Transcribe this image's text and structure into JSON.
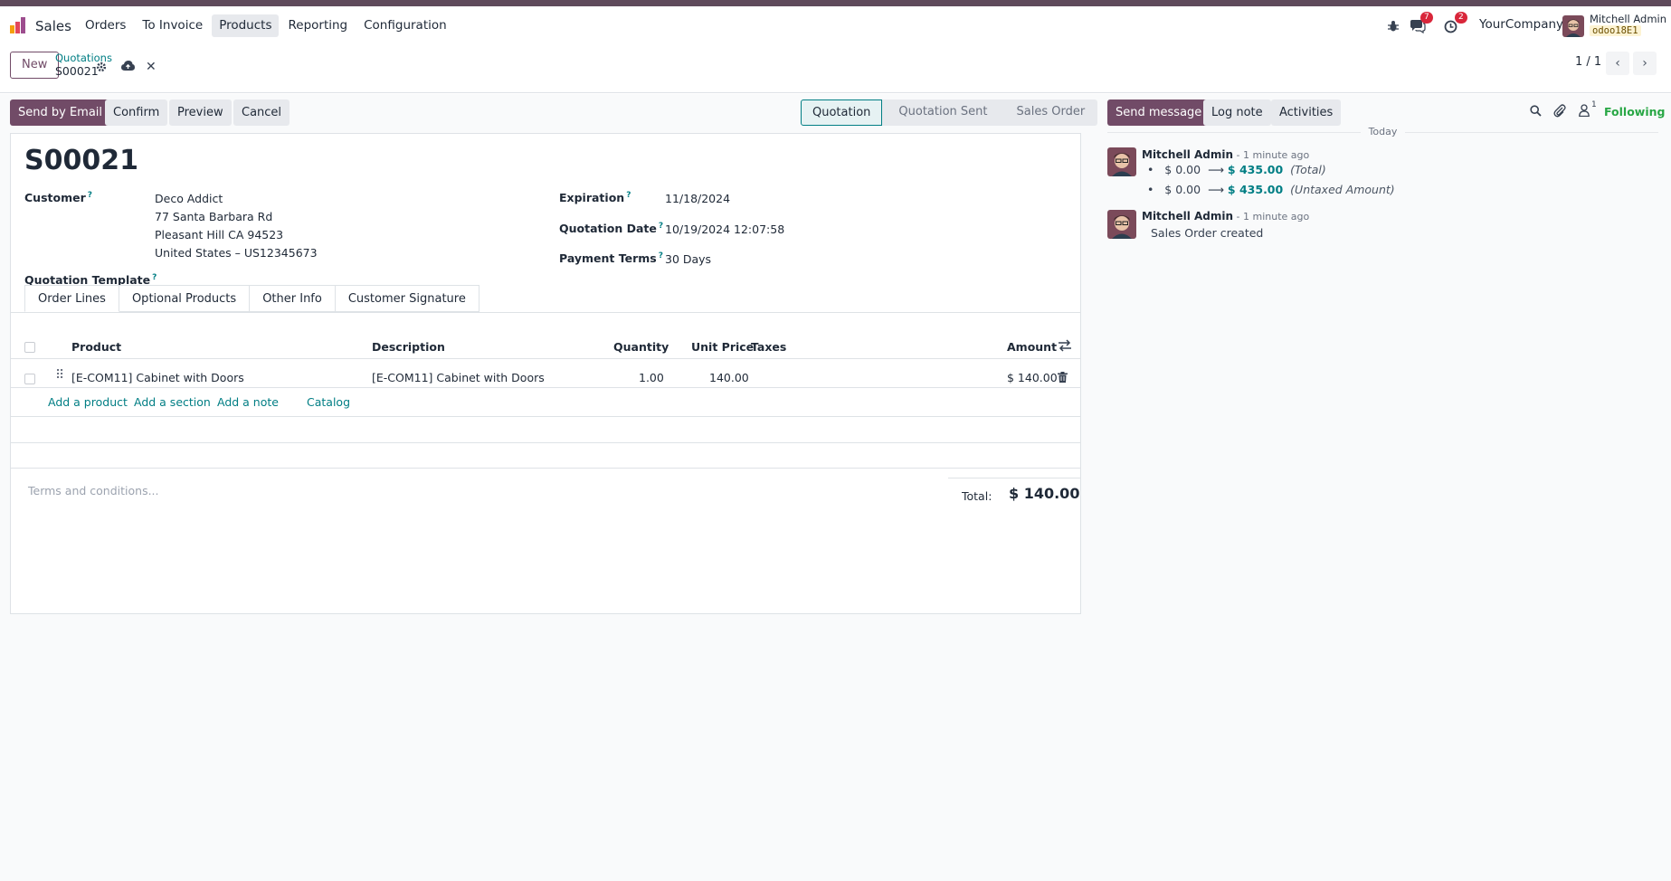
{
  "navbar": {
    "app_name": "Sales",
    "menu": [
      "Orders",
      "To Invoice",
      "Products",
      "Reporting",
      "Configuration"
    ],
    "active_menu": "Products",
    "messages_count": "7",
    "activities_count": "2",
    "company": "YourCompany",
    "user_name": "Mitchell Admin",
    "db_name": "odoo18E1"
  },
  "control": {
    "new_label": "New",
    "breadcrumb_parent": "Quotations",
    "breadcrumb_current": "S00021",
    "pager": "1 / 1"
  },
  "actions": {
    "send_email": "Send by Email",
    "confirm": "Confirm",
    "preview": "Preview",
    "cancel": "Cancel"
  },
  "statusbar": {
    "stages": [
      "Quotation",
      "Quotation Sent",
      "Sales Order"
    ],
    "current": "Quotation"
  },
  "form": {
    "title": "S00021",
    "customer_label": "Customer",
    "customer_name": "Deco Addict",
    "customer_street": "77 Santa Barbara Rd",
    "customer_city": "Pleasant Hill CA 94523",
    "customer_country": "United States – US12345673",
    "template_label": "Quotation Template",
    "expiration_label": "Expiration",
    "expiration_value": "11/18/2024",
    "quote_date_label": "Quotation Date",
    "quote_date_value": "10/19/2024 12:07:58",
    "payment_terms_label": "Payment Terms",
    "payment_terms_value": "30 Days",
    "help_mark": "?"
  },
  "tabs": [
    "Order Lines",
    "Optional Products",
    "Other Info",
    "Customer Signature"
  ],
  "lines": {
    "headers": {
      "product": "Product",
      "description": "Description",
      "quantity": "Quantity",
      "unit_price": "Unit Price",
      "taxes": "Taxes",
      "amount": "Amount"
    },
    "rows": [
      {
        "product": "[E-COM11] Cabinet with Doors",
        "description": "[E-COM11] Cabinet with Doors",
        "quantity": "1.00",
        "unit_price": "140.00",
        "taxes": "",
        "amount": "$ 140.00"
      }
    ],
    "add_product": "Add a product",
    "add_section": "Add a section",
    "add_note": "Add a note",
    "catalog": "Catalog"
  },
  "footer": {
    "terms_placeholder": "Terms and conditions...",
    "total_label": "Total:",
    "total_value": "$ 140.00"
  },
  "chatter": {
    "send_message": "Send message",
    "log_note": "Log note",
    "activities": "Activities",
    "followers_count": "1",
    "following": "Following",
    "day_label": "Today",
    "messages": [
      {
        "author": "Mitchell Admin",
        "when": " - 1 minute ago",
        "tracking": [
          {
            "old": "$ 0.00",
            "new": "$ 435.00",
            "field": "(Total)"
          },
          {
            "old": "$ 0.00",
            "new": "$ 435.00",
            "field": "(Untaxed Amount)"
          }
        ]
      },
      {
        "author": "Mitchell Admin",
        "when": " - 1 minute ago",
        "body": "Sales Order created"
      }
    ]
  },
  "colors": {
    "brand": "#714b67",
    "link": "#017e84",
    "badge": "#d9263a"
  }
}
